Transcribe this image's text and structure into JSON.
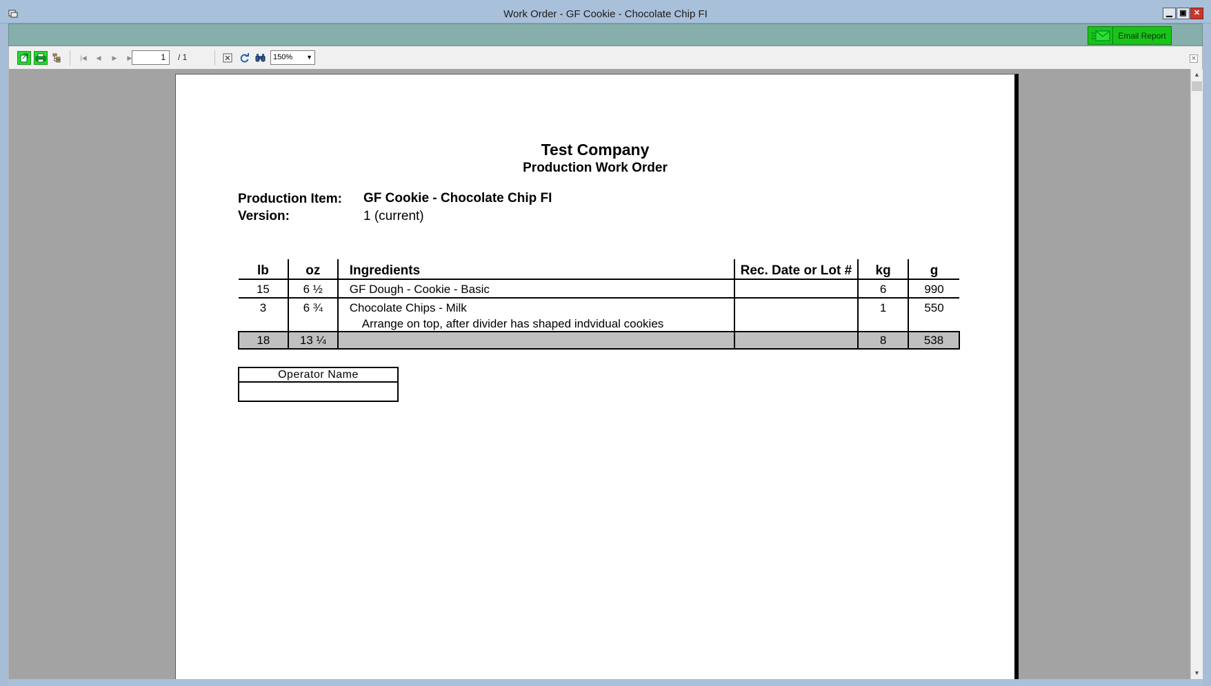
{
  "window": {
    "title": "Work Order - GF Cookie - Chocolate Chip FI",
    "minimize": "▁",
    "maximize": "▣",
    "close": "✕"
  },
  "actions": {
    "email_report_label": "Email Report"
  },
  "toolbar": {
    "page_current": "1",
    "page_total": "/ 1",
    "zoom": "150%",
    "icons": [
      "export-icon",
      "print-icon",
      "group-tree-icon",
      "first-page-icon",
      "previous-page-icon",
      "next-page-icon",
      "last-page-icon",
      "stop-icon",
      "refresh-icon",
      "search-icon"
    ]
  },
  "report": {
    "company": "Test Company",
    "subtitle": "Production Work Order",
    "production_item_label": "Production Item:",
    "production_item_value": "GF Cookie - Chocolate Chip FI",
    "version_label": "Version:",
    "version_value": "1 (current)",
    "table": {
      "headers": {
        "lb": "lb",
        "oz": "oz",
        "ingredients": "Ingredients",
        "rec": "Rec. Date or Lot #",
        "kg": "kg",
        "g": "g"
      },
      "rows": [
        {
          "lb": "15",
          "oz": "6 ½",
          "ingredient": "GF Dough - Cookie - Basic",
          "note": "",
          "rec": "",
          "kg": "6",
          "g": "990"
        },
        {
          "lb": "3",
          "oz": "6 ¾",
          "ingredient": "Chocolate Chips - Milk",
          "note": "Arrange on top, after divider has shaped indvidual cookies",
          "rec": "",
          "kg": "1",
          "g": "550"
        }
      ],
      "total": {
        "lb": "18",
        "oz": "13 ¼",
        "ingredient": "",
        "rec": "",
        "kg": "8",
        "g": "538"
      }
    },
    "operator_name_label": "Operator Name"
  },
  "colors": {
    "titlebar": "#a9c0da",
    "teal_bar": "#86aeaa",
    "email_button": "#19c419",
    "viewer_background": "#a3a3a3",
    "total_row": "#c0c0c0"
  }
}
